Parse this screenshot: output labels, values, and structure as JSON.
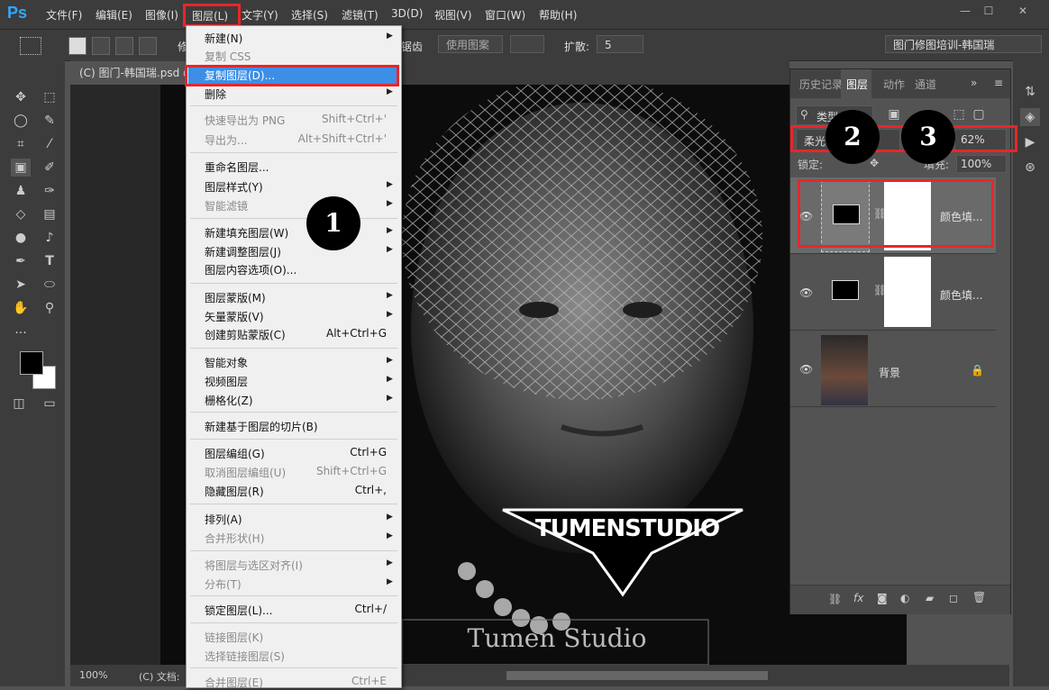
{
  "menubar": {
    "logo": "Ps",
    "items": [
      "文件(F)",
      "编辑(E)",
      "图像(I)",
      "图层(L)",
      "文字(Y)",
      "选择(S)",
      "滤镜(T)",
      "3D(D)",
      "视图(V)",
      "窗口(W)",
      "帮助(H)"
    ],
    "window_buttons": [
      "—",
      "☐",
      "✕"
    ]
  },
  "options": {
    "feather_label_partial": "修",
    "antialias_partial": "锯齿",
    "use_pattern": "使用图案",
    "expand_label": "扩散:",
    "expand_value": "5",
    "workspace": "图门修图培训-韩国瑞"
  },
  "document": {
    "tab_title": "(C) 图门-韩国瑞.psd @",
    "zoom": "100%",
    "doc_info": "(C) 文档:",
    "watermark_main": "TUMENSTUDIO",
    "watermark_sub": "Tumen Studio"
  },
  "layer_menu": {
    "items": [
      {
        "label": "新建(N)",
        "shortcut": "",
        "submenu": true,
        "disabled": false
      },
      {
        "label": "复制 CSS",
        "shortcut": "",
        "submenu": false,
        "disabled": true
      },
      {
        "label": "复制图层(D)...",
        "shortcut": "",
        "submenu": false,
        "disabled": false,
        "highlighted": true
      },
      {
        "label": "删除",
        "shortcut": "",
        "submenu": true,
        "disabled": false
      },
      {
        "label": "快速导出为 PNG",
        "shortcut": "Shift+Ctrl+'",
        "submenu": false,
        "disabled": true
      },
      {
        "label": "导出为...",
        "shortcut": "Alt+Shift+Ctrl+'",
        "submenu": false,
        "disabled": true
      },
      {
        "label": "重命名图层...",
        "shortcut": "",
        "submenu": false,
        "disabled": false
      },
      {
        "label": "图层样式(Y)",
        "shortcut": "",
        "submenu": true,
        "disabled": false
      },
      {
        "label": "智能滤镜",
        "shortcut": "",
        "submenu": true,
        "disabled": true
      },
      {
        "label": "新建填充图层(W)",
        "shortcut": "",
        "submenu": true,
        "disabled": false
      },
      {
        "label": "新建调整图层(J)",
        "shortcut": "",
        "submenu": true,
        "disabled": false
      },
      {
        "label": "图层内容选项(O)...",
        "shortcut": "",
        "submenu": false,
        "disabled": false
      },
      {
        "label": "图层蒙版(M)",
        "shortcut": "",
        "submenu": true,
        "disabled": false
      },
      {
        "label": "矢量蒙版(V)",
        "shortcut": "",
        "submenu": true,
        "disabled": false
      },
      {
        "label": "创建剪贴蒙版(C)",
        "shortcut": "Alt+Ctrl+G",
        "submenu": false,
        "disabled": false
      },
      {
        "label": "智能对象",
        "shortcut": "",
        "submenu": true,
        "disabled": false
      },
      {
        "label": "视频图层",
        "shortcut": "",
        "submenu": true,
        "disabled": false
      },
      {
        "label": "栅格化(Z)",
        "shortcut": "",
        "submenu": true,
        "disabled": false
      },
      {
        "label": "新建基于图层的切片(B)",
        "shortcut": "",
        "submenu": false,
        "disabled": false
      },
      {
        "label": "图层编组(G)",
        "shortcut": "Ctrl+G",
        "submenu": false,
        "disabled": false
      },
      {
        "label": "取消图层编组(U)",
        "shortcut": "Shift+Ctrl+G",
        "submenu": false,
        "disabled": true
      },
      {
        "label": "隐藏图层(R)",
        "shortcut": "Ctrl+,",
        "submenu": false,
        "disabled": false
      },
      {
        "label": "排列(A)",
        "shortcut": "",
        "submenu": true,
        "disabled": false
      },
      {
        "label": "合并形状(H)",
        "shortcut": "",
        "submenu": true,
        "disabled": true
      },
      {
        "label": "将图层与选区对齐(I)",
        "shortcut": "",
        "submenu": true,
        "disabled": true
      },
      {
        "label": "分布(T)",
        "shortcut": "",
        "submenu": true,
        "disabled": true
      },
      {
        "label": "锁定图层(L)...",
        "shortcut": "Ctrl+/",
        "submenu": false,
        "disabled": false
      },
      {
        "label": "链接图层(K)",
        "shortcut": "",
        "submenu": false,
        "disabled": true
      },
      {
        "label": "选择链接图层(S)",
        "shortcut": "",
        "submenu": false,
        "disabled": true
      },
      {
        "label": "合并图层(E)",
        "shortcut": "Ctrl+E",
        "submenu": false,
        "disabled": true
      }
    ]
  },
  "panel": {
    "tabs": [
      "历史记录",
      "图层",
      "动作",
      "通道"
    ],
    "filter_label": "类型",
    "blend_mode": "柔光",
    "opacity_value": "62%",
    "lock_label": "锁定:",
    "fill_label": "填充:",
    "fill_value": "100%",
    "layers": [
      {
        "name": "颜色填..."
      },
      {
        "name": "颜色填..."
      },
      {
        "name": "背景"
      }
    ]
  },
  "annotations": [
    "1",
    "2",
    "3"
  ]
}
